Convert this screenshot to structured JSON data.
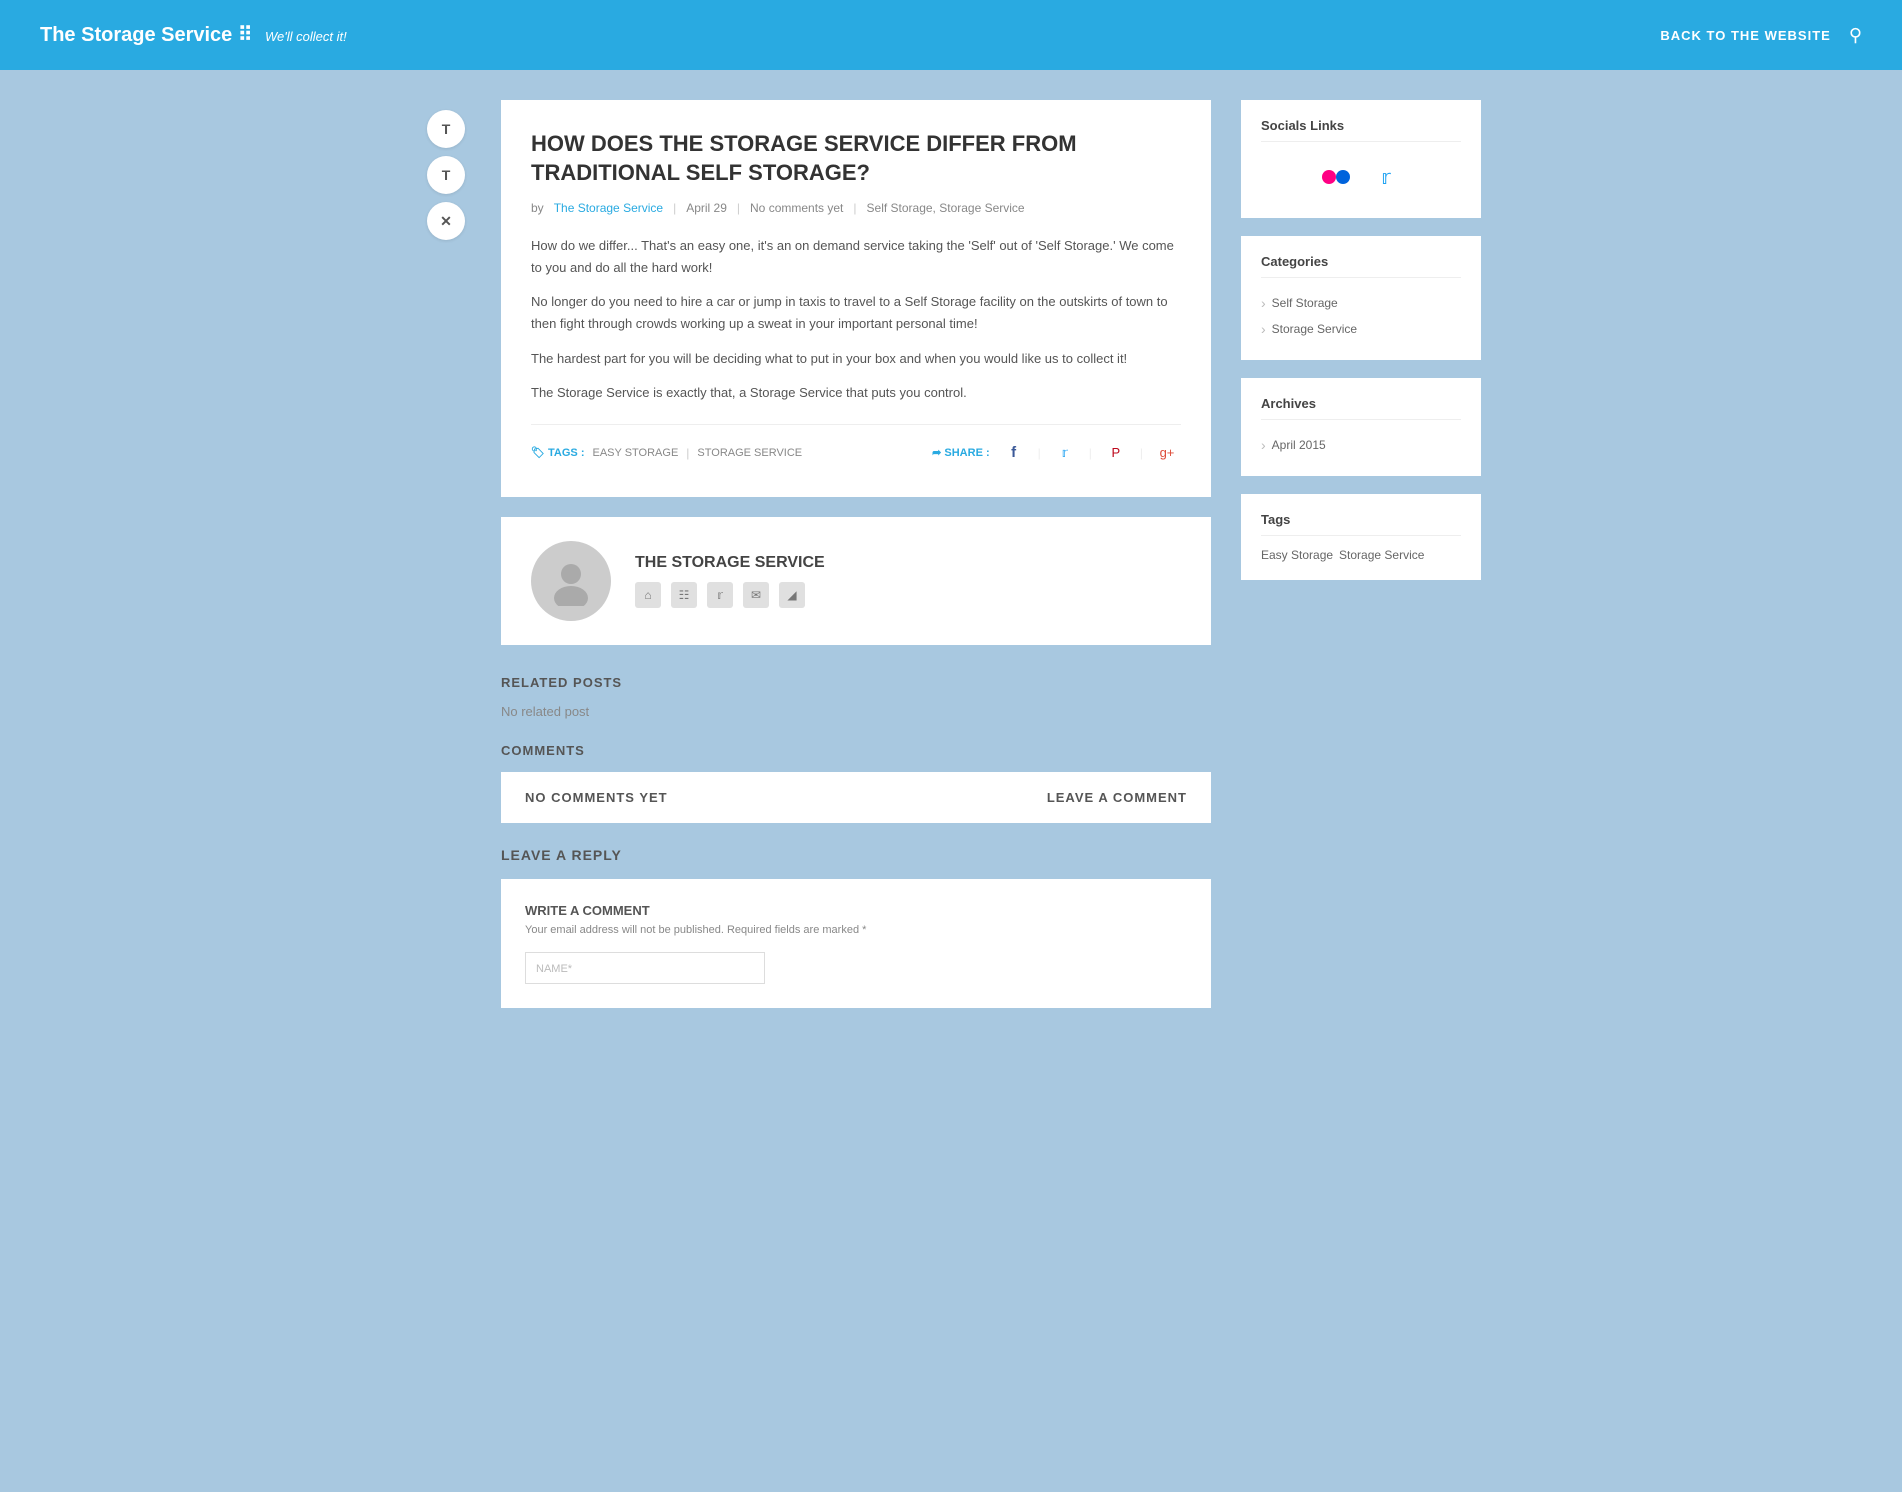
{
  "header": {
    "logo_title": "The Storage Service ⠿",
    "logo_sub": "We'll collect it!",
    "back_link": "BACK TO THE WEBSITE",
    "search_icon": "🔍"
  },
  "left_sidebar": {
    "buttons": [
      {
        "label": "T",
        "id": "share-t1"
      },
      {
        "label": "T",
        "id": "share-t2"
      },
      {
        "label": "✕",
        "id": "share-x"
      }
    ]
  },
  "article": {
    "title": "HOW DOES THE STORAGE SERVICE DIFFER FROM TRADITIONAL SELF STORAGE?",
    "meta": {
      "by": "by",
      "author": "The Storage Service",
      "date": "April 29",
      "comments": "No comments yet",
      "tags": "Self Storage, Storage Service"
    },
    "paragraphs": [
      "How do we differ... That's an easy one, it's an on demand service taking the 'Self' out of 'Self Storage.' We come to you and do all the hard work!",
      "No longer do you need to hire a car or jump in taxis to travel to a Self Storage facility on the outskirts of town to then fight through crowds working up a sweat in your important personal time!",
      "The hardest part for you will be deciding what to put in your box and when you would like us to collect it!",
      "The Storage Service is exactly that, a Storage Service that puts you control."
    ],
    "footer_tags": {
      "label": "TAGS :",
      "items": [
        "EASY STORAGE",
        "STORAGE SERVICE"
      ]
    },
    "footer_share": {
      "label": "SHARE :",
      "platforms": [
        "facebook",
        "twitter",
        "pinterest",
        "google-plus"
      ]
    }
  },
  "author": {
    "name": "THE STORAGE SERVICE",
    "icon_links": [
      "home",
      "grid",
      "twitter",
      "email",
      "rss"
    ]
  },
  "related_posts": {
    "section_title": "RELATED POSTS",
    "no_posts_text": "No related post"
  },
  "comments": {
    "section_title": "COMMENTS",
    "no_comments": "NO COMMENTS YET",
    "leave_comment": "LEAVE A COMMENT"
  },
  "reply": {
    "section_title": "LEAVE A REPLY",
    "write_label": "WRITE A COMMENT",
    "email_notice": "Your email address will not be published. Required fields are marked *",
    "name_placeholder": "NAME*"
  },
  "sidebar": {
    "socials": {
      "title": "Socials Links",
      "items": [
        {
          "name": "flickr",
          "symbol": "✿"
        },
        {
          "name": "twitter",
          "symbol": "🐦"
        }
      ]
    },
    "categories": {
      "title": "Categories",
      "items": [
        "Self Storage",
        "Storage Service"
      ]
    },
    "archives": {
      "title": "Archives",
      "items": [
        "April 2015"
      ]
    },
    "tags": {
      "title": "Tags",
      "items": [
        "Easy Storage",
        "Storage Service"
      ]
    }
  }
}
